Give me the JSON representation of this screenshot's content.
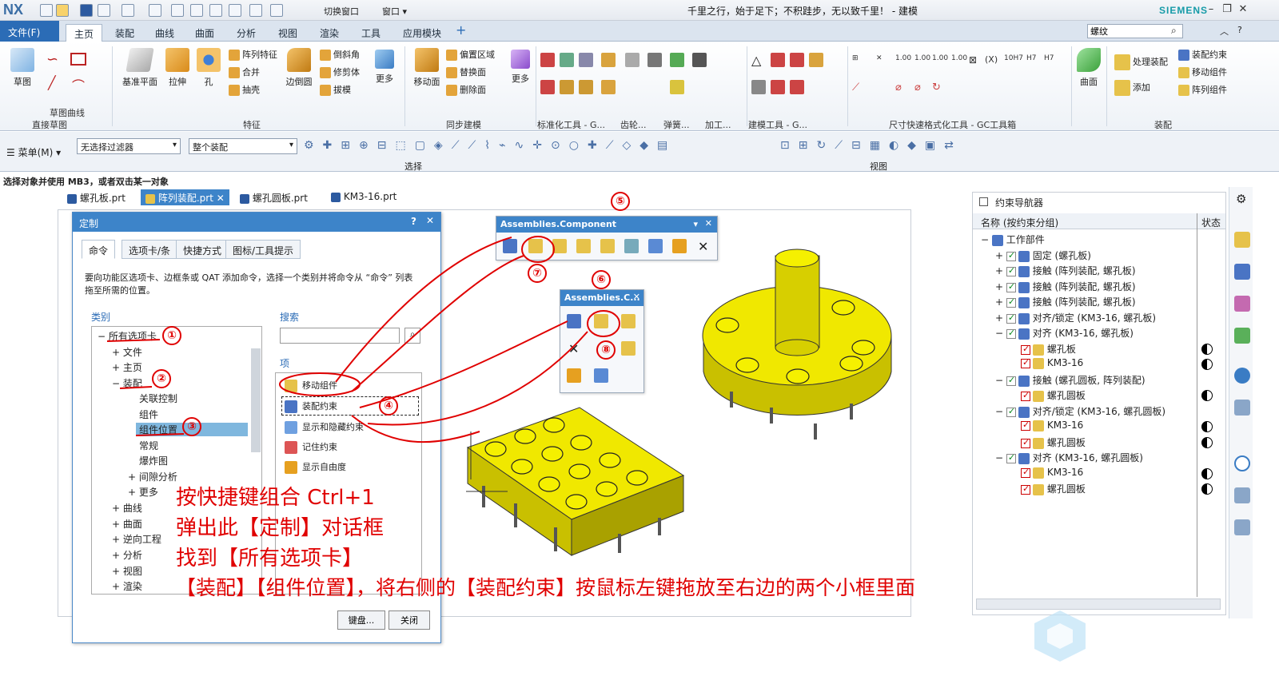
{
  "titlebar": {
    "logo": "NX",
    "title": "千里之行，始于足下；不积跬步，无以致千里！ - 建模",
    "brand": "SIEMENS"
  },
  "tabs": [
    {
      "label": "文件(F)"
    },
    {
      "label": "主页"
    },
    {
      "label": "装配"
    },
    {
      "label": "曲线"
    },
    {
      "label": "曲面"
    },
    {
      "label": "分析"
    },
    {
      "label": "视图"
    },
    {
      "label": "渲染"
    },
    {
      "label": "工具"
    },
    {
      "label": "应用模块"
    }
  ],
  "search": {
    "value": "螺纹"
  },
  "ribbon": {
    "sketch": "草图",
    "sketch_curve": "草图曲线",
    "direct_sketch": "直接草图",
    "datum_plane": "基准平面",
    "extrude": "拉伸",
    "hole": "孔",
    "pattern_feature": "阵列特征",
    "unite": "合并",
    "shell": "抽壳",
    "edge_blend": "边倒圆",
    "chamfer": "倒斜角",
    "trim_body": "修剪体",
    "draft": "拔模",
    "more1": "更多",
    "feature": "特征",
    "move_face": "移动面",
    "offset_region": "偏置区域",
    "replace_face": "替换面",
    "delete_face": "删除面",
    "more2": "更多",
    "sync_modeling": "同步建模",
    "std_tools": "标准化工具 - G...",
    "gear": "齿轮...",
    "spring": "弹簧...",
    "machining": "加工...",
    "build_tools": "建模工具 - G...",
    "dim_tools": "尺寸快速格式化工具 - GC工具箱",
    "surface": "曲面",
    "process_assembly": "处理装配",
    "add": "添加",
    "assembly_constraint": "装配约束",
    "move_component": "移动组件",
    "pattern_component": "阵列组件",
    "assembly": "装配"
  },
  "selbar": {
    "menu": "菜单(M)",
    "filter": "无选择过滤器",
    "scope": "整个装配",
    "selection": "选择",
    "view": "视图"
  },
  "status": "选择对象并使用 MB3，或者双击某一对象",
  "doc_tabs": [
    {
      "label": "螺孔板.prt"
    },
    {
      "label": "阵列装配.prt"
    },
    {
      "label": "螺孔圆板.prt"
    },
    {
      "label": "KM3-16.prt"
    }
  ],
  "dialog": {
    "title": "定制",
    "help": "?",
    "tabs": [
      "命令",
      "选项卡/条",
      "快捷方式",
      "图标/工具提示"
    ],
    "desc": "要向功能区选项卡、边框条或 QAT 添加命令，选择一个类别并将命令从 “命令” 列表拖至所需的位置。",
    "category_label": "类别",
    "search_label": "搜索",
    "items_label": "项",
    "tree": [
      "所有选项卡",
      "文件",
      "主页",
      "装配",
      "关联控制",
      "组件",
      "组件位置",
      "常规",
      "爆炸图",
      "间隙分析",
      "更多",
      "曲线",
      "曲面",
      "逆向工程",
      "分析",
      "视图",
      "渲染"
    ],
    "items": [
      "移动组件",
      "装配约束",
      "显示和隐藏约束",
      "记住约束",
      "显示自由度"
    ],
    "keyboard_btn": "键盘...",
    "close_btn": "关闭"
  },
  "toolbar1": {
    "title": "Assemblies.Component"
  },
  "toolbar2": {
    "title": "Assemblies.C..."
  },
  "annotations": {
    "n1": "①",
    "n2": "②",
    "n3": "③",
    "n4": "④",
    "n5": "⑤",
    "n6": "⑥",
    "n7": "⑦",
    "n8": "⑧",
    "line1": "按快捷键组合 Ctrl+1",
    "line2": "弹出此【定制】对话框",
    "line3": "找到【所有选项卡】",
    "line4": "【装配】【组件位置】，将右侧的【装配约束】按鼠标左键拖放至右边的两个小框里面"
  },
  "navigator": {
    "title": "约束导航器",
    "col_name": "名称 (按约束分组)",
    "col_status": "状态",
    "rows": [
      "工作部件",
      "固定 (螺孔板)",
      "接触 (阵列装配, 螺孔板)",
      "接触 (阵列装配, 螺孔板)",
      "接触 (阵列装配, 螺孔板)",
      "对齐/锁定 (KM3-16, 螺孔板)",
      "对齐 (KM3-16, 螺孔板)",
      "螺孔板",
      "KM3-16",
      "接触 (螺孔圆板, 阵列装配)",
      "螺孔圆板",
      "对齐/锁定 (KM3-16, 螺孔圆板)",
      "KM3-16",
      "螺孔圆板",
      "对齐 (KM3-16, 螺孔圆板)",
      "KM3-16",
      "螺孔圆板"
    ]
  },
  "colors": {
    "accent": "#3d84c9",
    "annotation": "#e00000",
    "part_yellow": "#e8e000"
  }
}
